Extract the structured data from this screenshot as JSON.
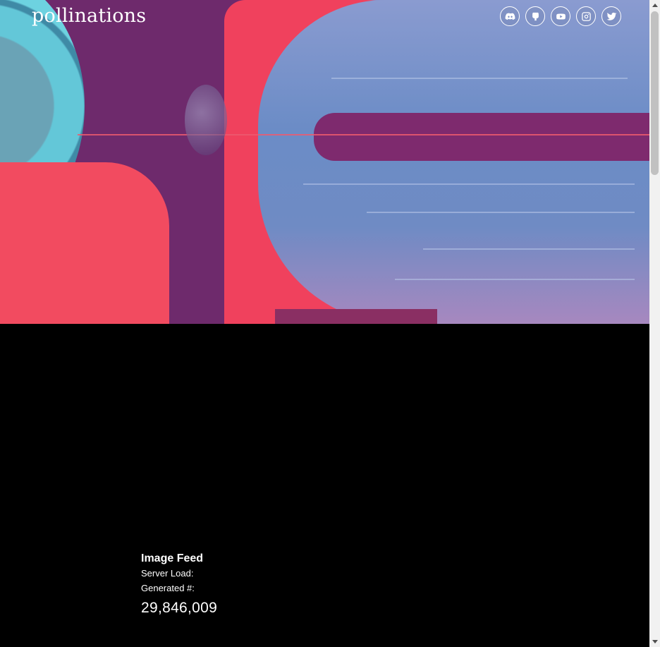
{
  "header": {
    "logo_text": "pollinations",
    "socials": [
      {
        "name": "discord",
        "icon": "discord-icon"
      },
      {
        "name": "github",
        "icon": "github-icon"
      },
      {
        "name": "youtube",
        "icon": "youtube-icon"
      },
      {
        "name": "instagram",
        "icon": "instagram-icon"
      },
      {
        "name": "twitter",
        "icon": "twitter-icon"
      }
    ]
  },
  "hero": {
    "image": "generated-artwork"
  },
  "feed": {
    "title": "Image Feed",
    "server_load_label": "Server Load:",
    "generated_label": "Generated #:",
    "generated_count": "29,846,009"
  },
  "colors": {
    "background": "#000000",
    "text": "#ffffff",
    "accent_red": "#f0415d",
    "accent_blue": "#6f86bd",
    "accent_purple": "#6e2a6c"
  }
}
